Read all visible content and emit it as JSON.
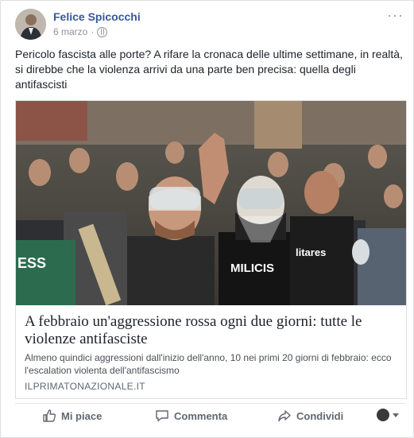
{
  "post": {
    "author": "Felice Spicocchi",
    "date": "6 marzo",
    "separator": "·",
    "privacy_icon": "globe-icon",
    "more_icon": "ellipsis-icon",
    "more_label": "···",
    "text": "Pericolo fascista alle porte? A rifare la cronaca delle ultime settimane, in realtà, si direbbe che la violenza arrivi da una parte ben precisa: quella degli antifascisti"
  },
  "link_card": {
    "title": "A febbraio un'aggressione rossa ogni due giorni: tutte le violenze antifasciste",
    "description": "Almeno quindici aggressioni dall'inizio dell'anno, 10 nei primi 20 giorni di febbraio: ecco l'escalation violenta dell'antifascismo",
    "domain": "ILPRIMATONAZIONALE.IT",
    "image_shirt_text_1": "MILICIS",
    "image_shirt_text_2": "ESS",
    "image_shirt_text_3": "litares"
  },
  "actions": {
    "like": "Mi piace",
    "comment": "Commenta",
    "share": "Condividi"
  },
  "colors": {
    "author_link": "#365899",
    "meta_gray": "#90949c",
    "action_gray": "#606770"
  }
}
